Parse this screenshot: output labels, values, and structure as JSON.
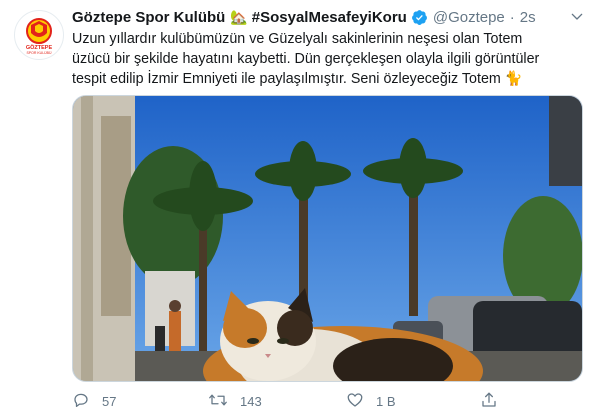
{
  "tweet": {
    "author_name": "Göztepe Spor Kulübü",
    "house_emoji": "🏡",
    "hashtag": "#SosyalMesafeyiKoru",
    "handle": "@Goztepe",
    "separator": "·",
    "time": "2s",
    "avatar_text": "GÖZTEPE",
    "avatar_subtext": "SPOR KULÜBÜ",
    "line1": "Uzun yıllardır kulübümüzün ve Güzelyalı sakinlerinin neşesi olan Totem",
    "line2": "üzücü bir şekilde hayatını kaybetti. Dün gerçekleşen olayla ilgili görüntüler",
    "line3": "tespit edilip İzmir Emniyeti ile paylaşılmıştır. Seni özleyeceğiz Totem 🐈"
  },
  "actions": {
    "reply_count": "57",
    "retweet_count": "143",
    "like_count": "1 B"
  },
  "icons": {
    "verified": "verified-badge-icon",
    "caret": "chevron-down-icon",
    "reply": "reply-icon",
    "retweet": "retweet-icon",
    "like": "heart-icon",
    "share": "share-icon"
  },
  "colors": {
    "verified": "#1da1f2",
    "icon_gray": "#657786",
    "club_red": "#e2231a",
    "club_yellow": "#ffcc00"
  }
}
